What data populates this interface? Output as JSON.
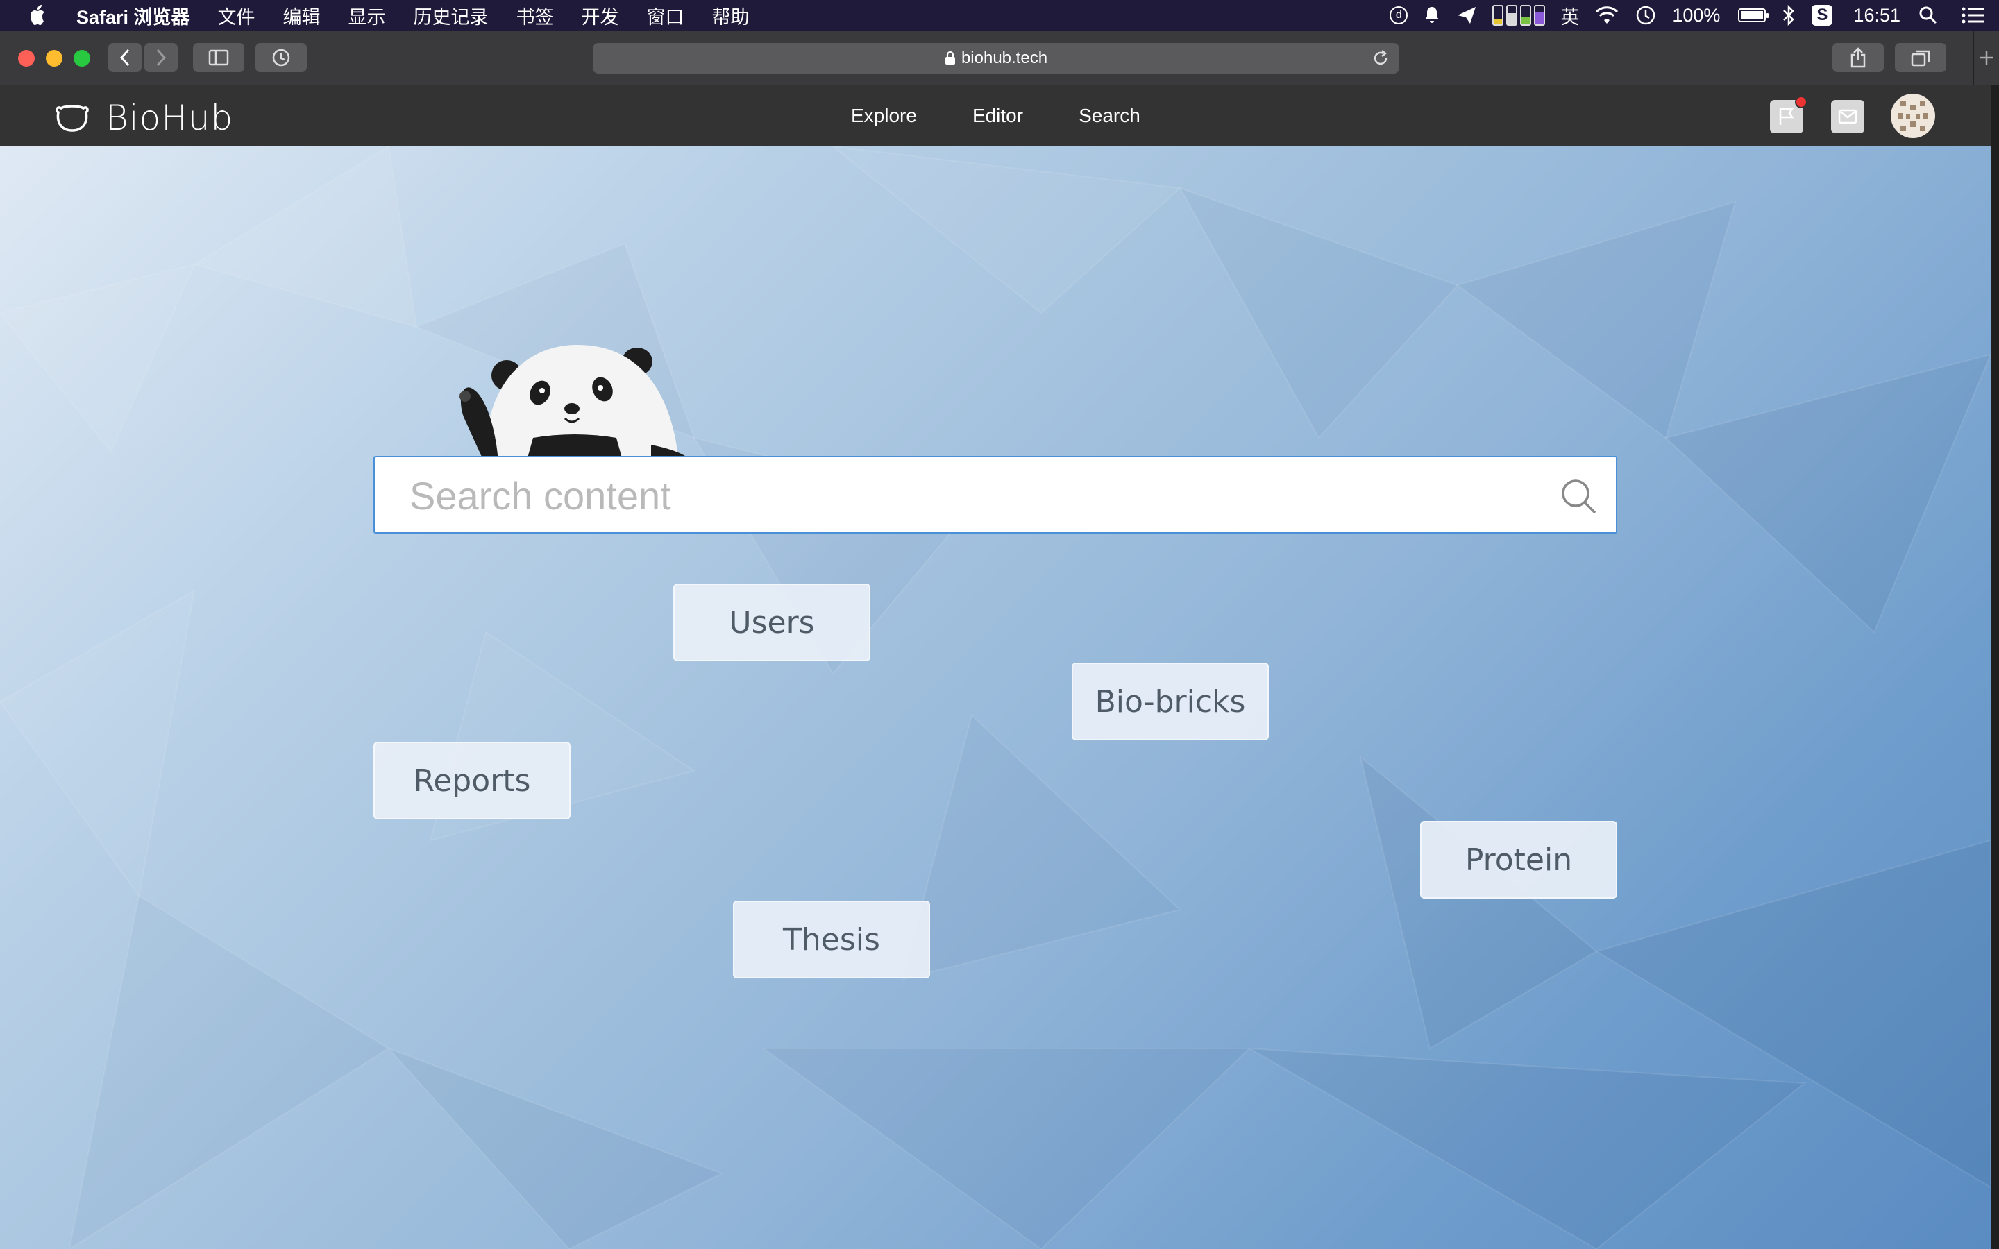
{
  "menubar": {
    "app_name": "Safari 浏览器",
    "menus": [
      "文件",
      "编辑",
      "显示",
      "历史记录",
      "书签",
      "开发",
      "窗口",
      "帮助"
    ],
    "status_letters": [
      "d"
    ],
    "input_method": "英",
    "battery_percent": "100%",
    "time": "16:51"
  },
  "browser": {
    "url": "biohub.tech"
  },
  "site": {
    "logo_text": "BioHub",
    "nav": [
      "Explore",
      "Editor",
      "Search"
    ],
    "notification_badge": true,
    "colors": {
      "header": "#333333",
      "search_border": "#4a90d9"
    }
  },
  "search": {
    "placeholder": "Search content"
  },
  "tags": {
    "users": "Users",
    "biobricks": "Bio-bricks",
    "reports": "Reports",
    "protein": "Protein",
    "thesis": "Thesis"
  }
}
